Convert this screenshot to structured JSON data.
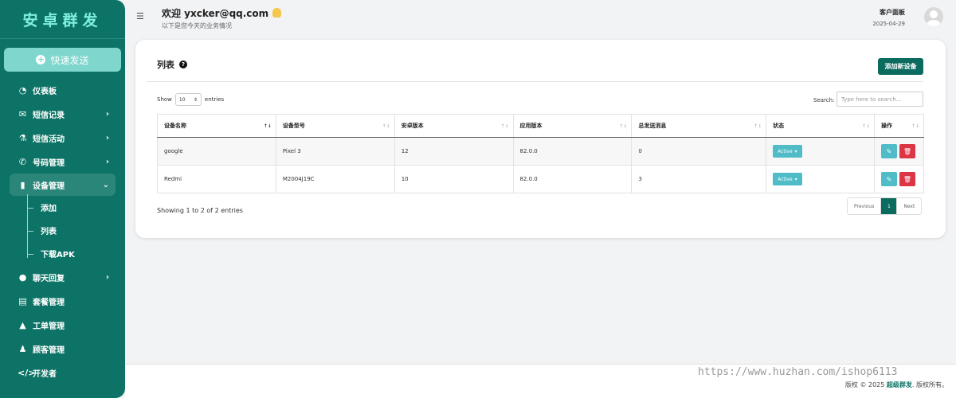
{
  "sidebar": {
    "brand": "安卓群发",
    "quick_send": "快速发送",
    "items": [
      {
        "label": "仪表板",
        "icon": "dashboard-icon",
        "glyph": "◔",
        "chevron": ""
      },
      {
        "label": "短信记录",
        "icon": "envelope-icon",
        "glyph": "✉",
        "chevron": "›"
      },
      {
        "label": "短信活动",
        "icon": "flask-icon",
        "glyph": "⚗",
        "chevron": "›"
      },
      {
        "label": "号码管理",
        "icon": "phone-icon",
        "glyph": "✆",
        "chevron": "›"
      }
    ],
    "active_item": {
      "label": "设备管理",
      "icon": "mobile-icon",
      "glyph": "▮",
      "chevron": "⌄"
    },
    "sub_items": [
      "添加",
      "列表",
      "下载APK"
    ],
    "items_after": [
      {
        "label": "聊天回复",
        "icon": "chat-icon",
        "glyph": "●",
        "chevron": "›"
      },
      {
        "label": "套餐管理",
        "icon": "file-icon",
        "glyph": "▤",
        "chevron": ""
      },
      {
        "label": "工单管理",
        "icon": "warning-icon",
        "glyph": "▲",
        "chevron": ""
      },
      {
        "label": "顾客管理",
        "icon": "user-plus-icon",
        "glyph": "♟",
        "chevron": ""
      },
      {
        "label": "开发者",
        "icon": "code-icon",
        "glyph": "</>",
        "chevron": ""
      }
    ]
  },
  "header": {
    "welcome": "欢迎 yxcker@qq.com",
    "subtitle": "以下是您今天的业务情况",
    "panel_title": "客户面板",
    "date": "2025-04-29"
  },
  "card": {
    "title": "列表",
    "add_button": "添加新设备",
    "show_label": "Show",
    "entries_value": "10",
    "entries_label": "entries",
    "search_label": "Search:",
    "search_placeholder": "Type here to search...",
    "columns": [
      "设备名称",
      "设备型号",
      "安卓版本",
      "应用版本",
      "总发送消息",
      "状态",
      "操作"
    ],
    "rows": [
      {
        "name": "google",
        "model": "Pixel 3",
        "android": "12",
        "app": "82.0.0",
        "sent": "0",
        "status": "Active"
      },
      {
        "name": "Redmi",
        "model": "M2004J19C",
        "android": "10",
        "app": "82.0.0",
        "sent": "3",
        "status": "Active"
      }
    ],
    "info": "Showing 1 to 2 of 2 entries",
    "pager": {
      "prev": "Previous",
      "current": "1",
      "next": "Next"
    }
  },
  "footer": {
    "watermark": "https://www.huzhan.com/ishop6113",
    "copyright_prefix": "版权 © 2025",
    "copyright_brand": "超级群发",
    "copyright_suffix": ". 版权所有。"
  },
  "colors": {
    "sidebar": "#0d7366",
    "accent": "#0b6b5f",
    "info": "#50bcc8",
    "danger": "#dc3545"
  }
}
